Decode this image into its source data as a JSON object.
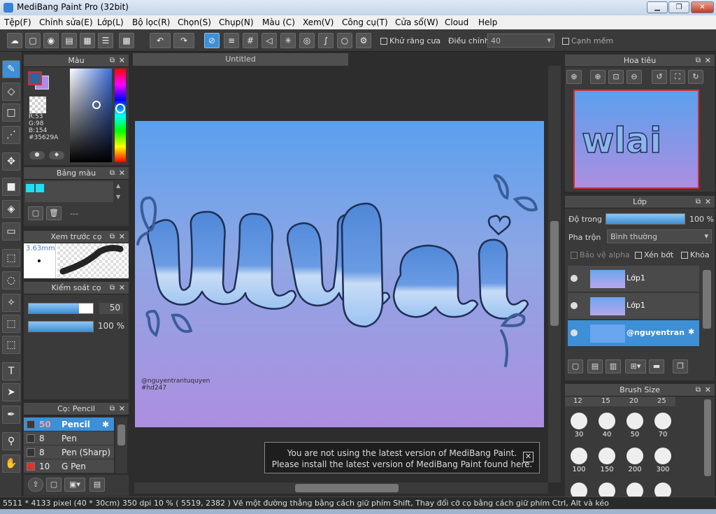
{
  "window": {
    "title": "MediBang Paint Pro (32bit)",
    "btn_min": "▁",
    "btn_max": "❐",
    "btn_close": "✕"
  },
  "menu": [
    "Tệp(F)",
    "Chỉnh sửa(E)",
    "Lớp(L)",
    "Bộ lọc(R)",
    "Chọn(S)",
    "Chụp(N)",
    "Màu (C)",
    "Xem(V)",
    "Công cụ(T)",
    "Cửa sổ(W)",
    "Cloud",
    "Help"
  ],
  "toolbar": {
    "antialias_label": "Khử răng cưa",
    "adjust_label": "Điều chỉnh",
    "adjust_value": "40",
    "soft_edge_label": "Cạnh mềm"
  },
  "color_panel": {
    "title": "Màu",
    "r": "R:53",
    "g": "G:98",
    "b": "B:154",
    "hex": "#35629A"
  },
  "palette_panel": {
    "title": "Bảng màu",
    "item": "---"
  },
  "brush_preview": {
    "title": "Xem trước cọ",
    "size": "3.63mm"
  },
  "brush_control": {
    "title": "Kiểm soát cọ",
    "size_value": "50",
    "opacity_value": "100 %"
  },
  "brush_list": {
    "title": "Cọ: Pencil",
    "items": [
      {
        "size": "50",
        "name": "Pencil",
        "color": "#3a3a3a"
      },
      {
        "size": "8",
        "name": "Pen",
        "color": "#333333"
      },
      {
        "size": "8",
        "name": "Pen (Sharp)",
        "color": "#333333"
      },
      {
        "size": "10",
        "name": "G Pen",
        "color": "#e03030"
      }
    ]
  },
  "document": {
    "tab": "Untitled",
    "watermark_line1": "@nguyentrantuquyen",
    "watermark_line2": "#hd247"
  },
  "notice": {
    "line1": "You are not using the latest version of MediBang Paint.",
    "line2": "Please install the latest version of MediBang Paint found here.",
    "close": "✕"
  },
  "navigator": {
    "title": "Hoa tiêu"
  },
  "layers": {
    "title": "Lớp",
    "opacity_label": "Độ trong",
    "opacity_value": "100 %",
    "blend_label": "Pha trộn",
    "blend_value": "Bình thường",
    "protect_alpha": "Bảo vệ alpha",
    "clip": "Xén bớt",
    "lock": "Khóa",
    "items": [
      {
        "name": "Lớp1"
      },
      {
        "name": "Lớp1"
      },
      {
        "name": "@nguyentran"
      }
    ]
  },
  "brush_size": {
    "title": "Brush Size",
    "top_labels": [
      "12",
      "15",
      "20",
      "25"
    ],
    "row1": [
      "30",
      "40",
      "50",
      "70"
    ],
    "row2": [
      "100",
      "150",
      "200",
      "300"
    ]
  },
  "status": {
    "text": "5511 * 4133 pixel  (40 * 30cm)  350 dpi  10 %  ( 5519, 2382 )  Vẽ một đường thẳng bằng cách giữ phím Shift, Thay đổi cỡ cọ bằng cách giữ phím Ctrl, Alt và kéo"
  },
  "colors": {
    "accent": "#3d8fd6",
    "foreground": "#35629A",
    "background_swatch": "#b48ae6",
    "palette1": "#1de0f0",
    "palette2": "#1de0f0"
  }
}
